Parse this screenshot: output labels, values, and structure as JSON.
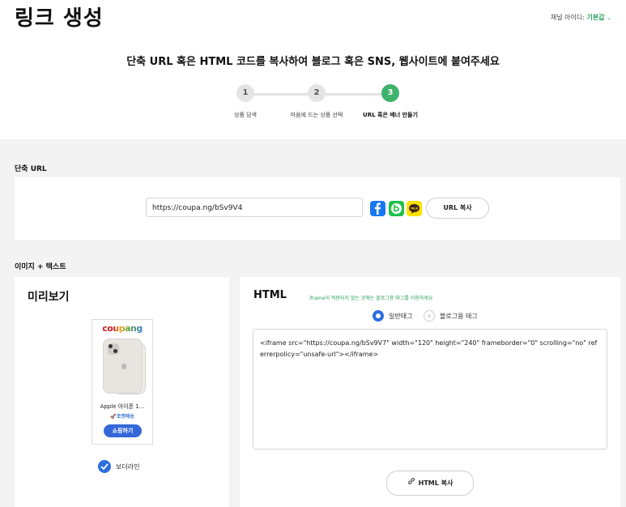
{
  "header": {
    "title": "링크 생성",
    "channel_label": "채널 아이디:",
    "channel_value": "기본값",
    "headline": "단축 URL 혹은 HTML 코드를 복사하여 블로그 혹은 SNS, 웹사이트에 붙여주세요"
  },
  "steps": [
    {
      "number": "1",
      "label": "상품 담색"
    },
    {
      "number": "2",
      "label": "마음에 드는 상품 선택"
    },
    {
      "number": "3",
      "label": "URL 혹은 배너 만들기"
    }
  ],
  "short_url": {
    "section_title": "단축 URL",
    "value": "https://coupa.ng/bSv9V4",
    "copy_label": "URL 복사",
    "share_icons": [
      "facebook-icon",
      "band-icon",
      "kakaotalk-icon"
    ]
  },
  "image_text": {
    "section_title": "이미지 + 텍스트",
    "preview_title": "미리보기",
    "banner": {
      "logo": "coupang",
      "product_name": "Apple 아이폰 1...",
      "rocket": "로켓배송",
      "button": "쇼핑하기"
    },
    "border_label": "보더라인",
    "border_checked": true
  },
  "html": {
    "title": "HTML",
    "note": "iframe이 적용되지 않는 곳에는 블로그용 태그를 이용하세요",
    "radio_normal": "일반태그",
    "radio_blog": "블로그용 태그",
    "code": "<iframe src=\"https://coupa.ng/bSv9V7\" width=\"120\" height=\"240\" frameborder=\"0\" scrolling=\"no\" referrerpolicy=\"unsafe-url\"></iframe>",
    "copy_label": "HTML 복사"
  },
  "colors": {
    "accent_green": "#3db36b",
    "primary_blue": "#2e6ee0"
  }
}
